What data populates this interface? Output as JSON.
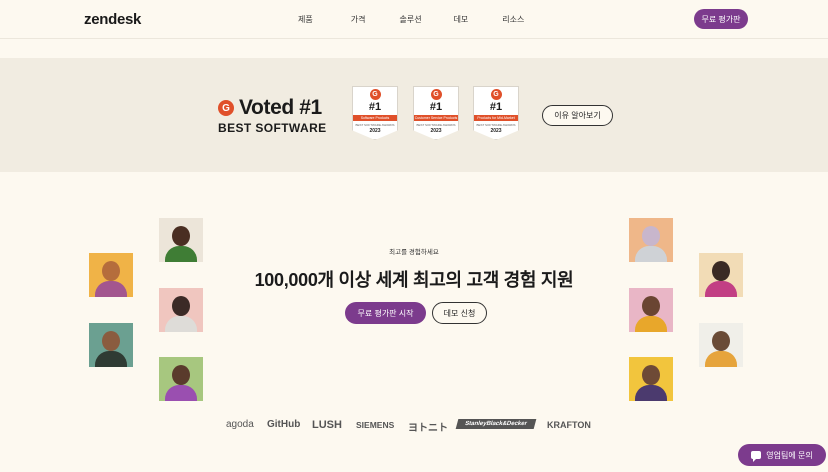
{
  "header": {
    "logo": "zendesk",
    "nav": [
      "제품",
      "가격",
      "솔루션",
      "데모",
      "리소스"
    ],
    "trial_button": "무료 평가판"
  },
  "award": {
    "g2_letter": "G",
    "voted": "Voted #1",
    "best": "BEST SOFTWARE",
    "badges": [
      {
        "g2": "G",
        "rank": "#1",
        "category": "Software Products",
        "sub": "BEST SOFTWARE AWARDS",
        "year": "2023"
      },
      {
        "g2": "G",
        "rank": "#1",
        "category": "Customer Service Products",
        "sub": "BEST SOFTWARE AWARDS",
        "year": "2023"
      },
      {
        "g2": "G",
        "rank": "#1",
        "category": "Products for Mid-Market",
        "sub": "BEST SOFTWARE AWARDS",
        "year": "2023"
      }
    ],
    "learn_more": "이유 알아보기"
  },
  "hero": {
    "eyebrow": "최고를 경험하세요",
    "headline": "100,000개 이상 세계 최고의 고객 경험 지원",
    "primary_button": "무료 평가판 시작",
    "secondary_button": "데모 신청"
  },
  "logos": [
    "agoda",
    "GitHub",
    "LUSH",
    "SIEMENS",
    "ヨトニト",
    "StanleyBlack&Decker",
    "KRAFTON"
  ],
  "contact_button": "영업팀에 문의",
  "colors": {
    "accent": "#7c3b8d",
    "g2_red": "#e0502a",
    "background": "#fdf9f0",
    "band": "#f1ece1"
  }
}
